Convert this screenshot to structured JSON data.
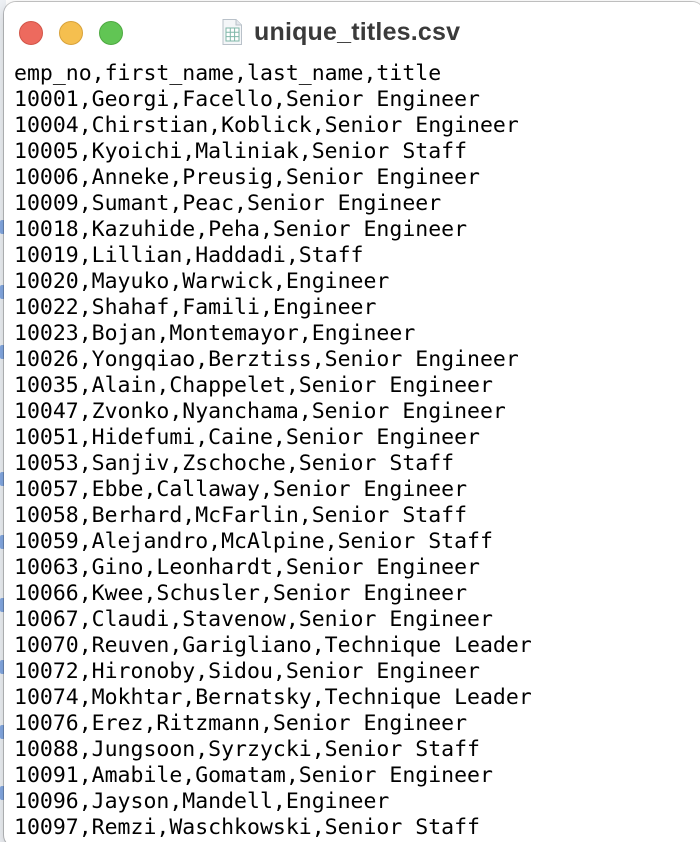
{
  "window": {
    "title": "unique_titles.csv",
    "file_icon": "spreadsheet-document-icon"
  },
  "buttons": {
    "close": "close-icon",
    "minimize": "minimize-icon",
    "zoom": "zoom-icon"
  },
  "colors": {
    "close": "#ed6a5e",
    "minimize": "#f5bf4f",
    "zoom": "#61c554",
    "title_text": "#3a3a3a"
  },
  "file": {
    "lines": [
      "emp_no,first_name,last_name,title",
      "10001,Georgi,Facello,Senior Engineer",
      "10004,Chirstian,Koblick,Senior Engineer",
      "10005,Kyoichi,Maliniak,Senior Staff",
      "10006,Anneke,Preusig,Senior Engineer",
      "10009,Sumant,Peac,Senior Engineer",
      "10018,Kazuhide,Peha,Senior Engineer",
      "10019,Lillian,Haddadi,Staff",
      "10020,Mayuko,Warwick,Engineer",
      "10022,Shahaf,Famili,Engineer",
      "10023,Bojan,Montemayor,Engineer",
      "10026,Yongqiao,Berztiss,Senior Engineer",
      "10035,Alain,Chappelet,Senior Engineer",
      "10047,Zvonko,Nyanchama,Senior Engineer",
      "10051,Hidefumi,Caine,Senior Engineer",
      "10053,Sanjiv,Zschoche,Senior Staff",
      "10057,Ebbe,Callaway,Senior Engineer",
      "10058,Berhard,McFarlin,Senior Staff",
      "10059,Alejandro,McAlpine,Senior Staff",
      "10063,Gino,Leonhardt,Senior Engineer",
      "10066,Kwee,Schusler,Senior Engineer",
      "10067,Claudi,Stavenow,Senior Engineer",
      "10070,Reuven,Garigliano,Technique Leader",
      "10072,Hironoby,Sidou,Senior Engineer",
      "10074,Mokhtar,Bernatsky,Technique Leader",
      "10076,Erez,Ritzmann,Senior Engineer",
      "10088,Jungsoon,Syrzycki,Senior Staff",
      "10091,Amabile,Gomatam,Senior Engineer",
      "10096,Jayson,Mandell,Engineer",
      "10097,Remzi,Waschkowski,Senior Staff"
    ]
  }
}
